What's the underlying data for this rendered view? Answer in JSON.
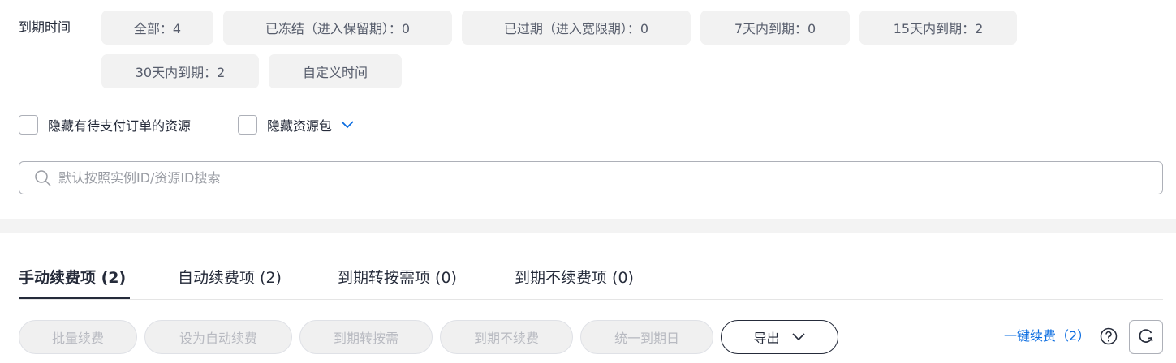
{
  "filter": {
    "label": "到期时间",
    "chips": [
      {
        "label": "全部：4"
      },
      {
        "label": "已冻结（进入保留期）：0"
      },
      {
        "label": "已过期（进入宽限期）：0"
      },
      {
        "label": "7天内到期：0"
      },
      {
        "label": "15天内到期：2"
      },
      {
        "label": "30天内到期：2"
      },
      {
        "label": "自定义时间"
      }
    ]
  },
  "checkboxes": {
    "hide_pending": "隐藏有待支付订单的资源",
    "hide_packages": "隐藏资源包"
  },
  "search": {
    "placeholder": "默认按照实例ID/资源ID搜索",
    "value": ""
  },
  "tabs": [
    {
      "label": "手动续费项 (2)",
      "active": true
    },
    {
      "label": "自动续费项 (2)"
    },
    {
      "label": "到期转按需项 (0)"
    },
    {
      "label": "到期不续费项 (0)"
    }
  ],
  "toolbar": {
    "batch_renew": "批量续费",
    "set_auto_renew": "设为自动续费",
    "to_on_demand": "到期转按需",
    "no_renew": "到期不续费",
    "unify_expiry": "统一到期日",
    "export": "导出",
    "one_click_renew": "一键续费（2）"
  },
  "colors": {
    "link": "#0a6ce0",
    "text": "#252b3a",
    "chip_bg": "#f2f2f2"
  }
}
